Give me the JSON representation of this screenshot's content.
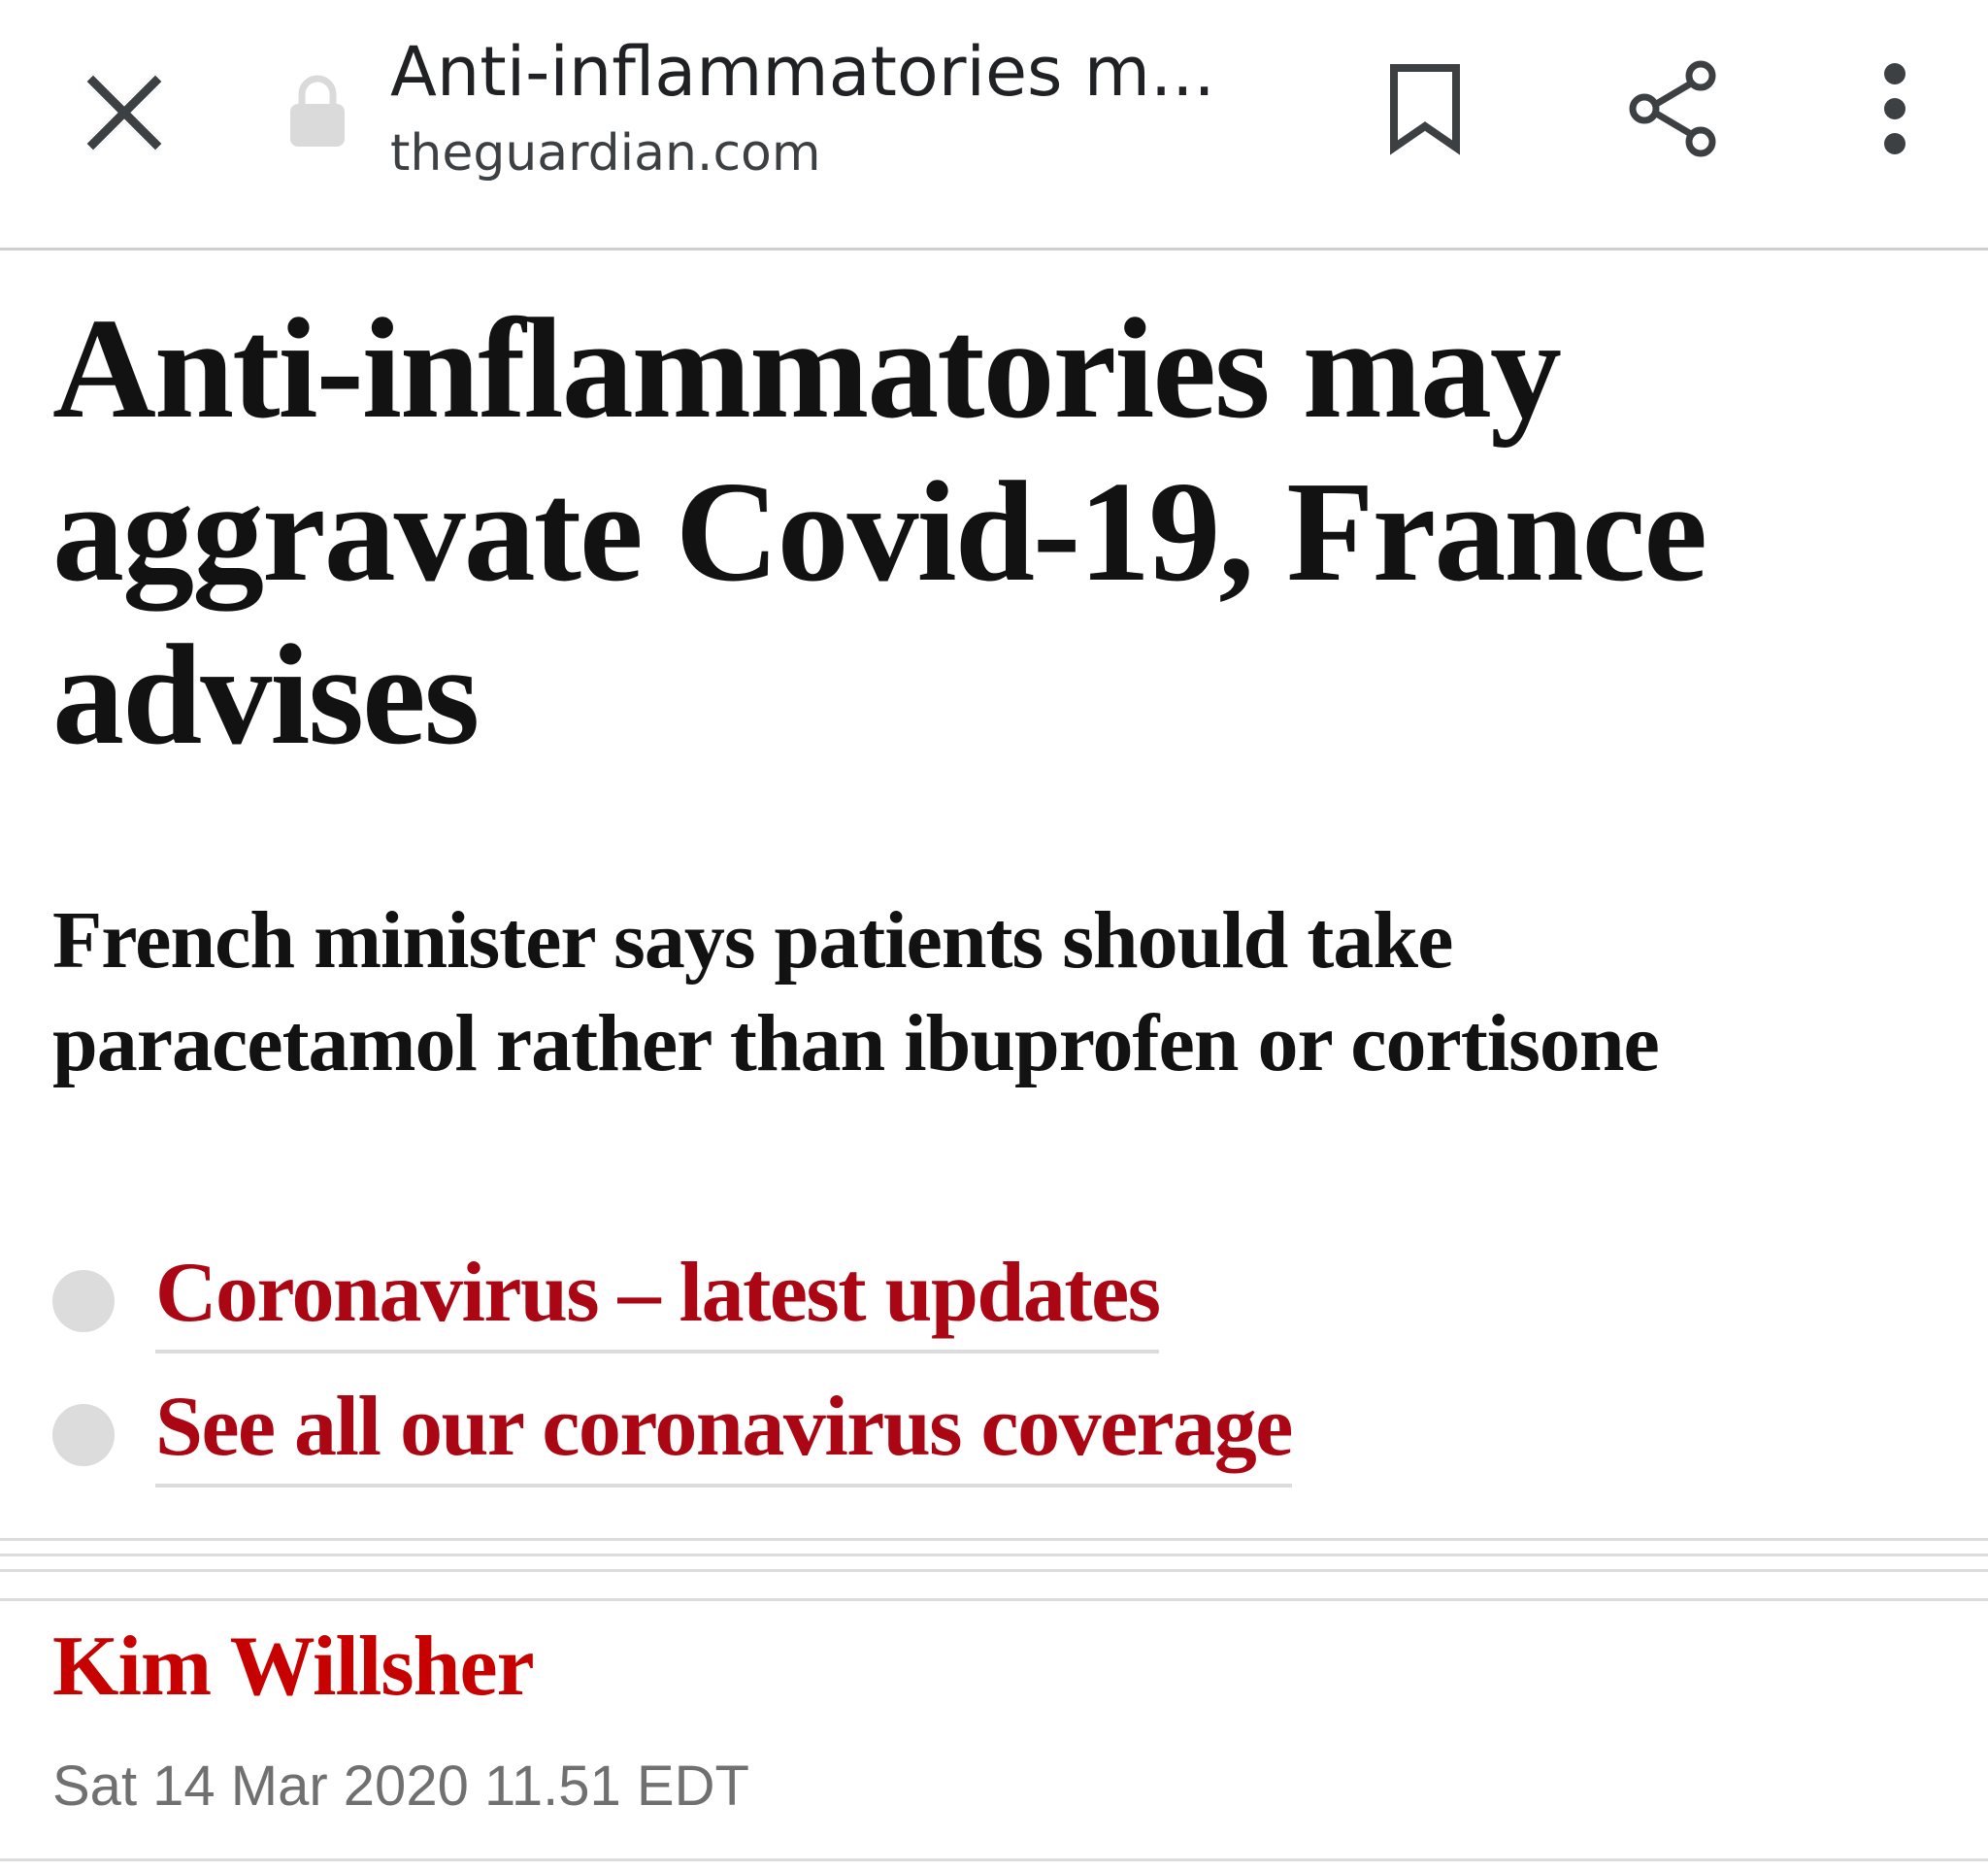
{
  "browser": {
    "tab_title": "Anti-inflammatories m...",
    "domain": "theguardian.com",
    "icons": {
      "close": "close-icon",
      "lock": "lock-icon",
      "bookmark": "bookmark-icon",
      "share": "share-icon",
      "menu": "more-vert-icon"
    }
  },
  "article": {
    "headline": "Anti-inflammatories may aggravate Covid-19, France advises",
    "standfirst": "French minister says patients should take paracetamol rather than ibuprofen or cortisone",
    "links": [
      {
        "label": "Coronavirus – latest updates"
      },
      {
        "label": "See all our coronavirus coverage"
      }
    ],
    "byline": "Kim Willsher",
    "dateline": "Sat 14 Mar 2020 11.51 EDT"
  },
  "colors": {
    "link": "#ab0613",
    "byline": "#c70000",
    "text": "#121212",
    "meta": "#707070",
    "rule": "#dcdcdc"
  }
}
